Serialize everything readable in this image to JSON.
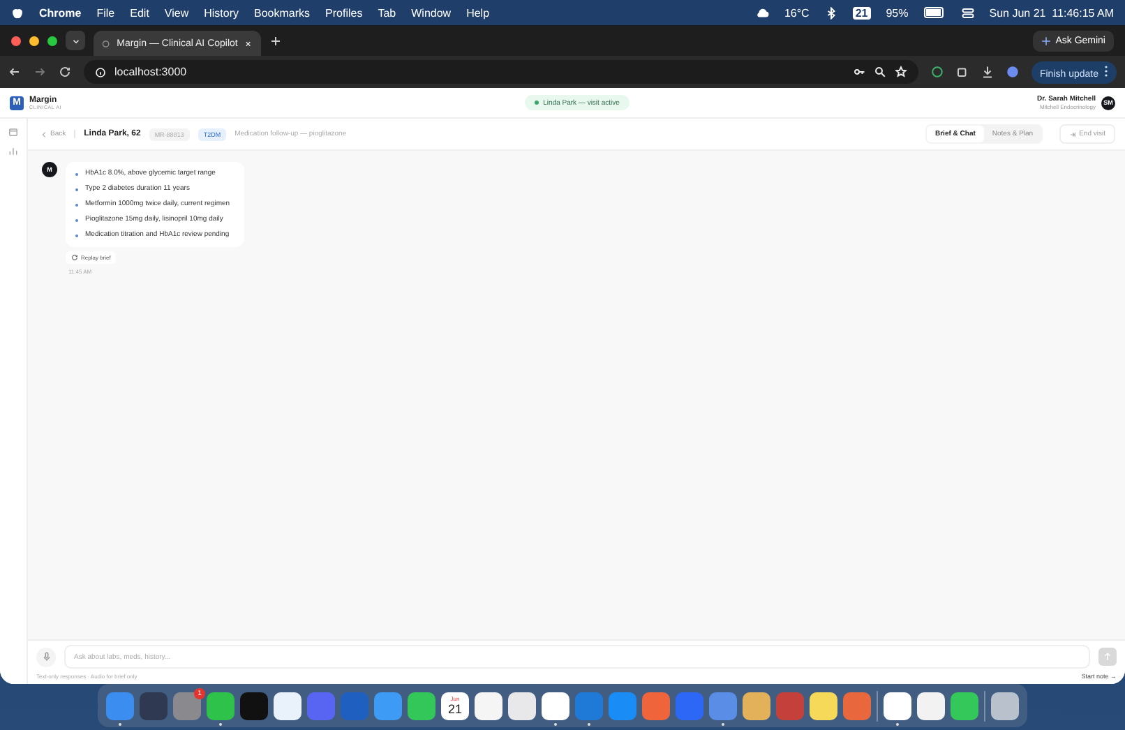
{
  "menubar": {
    "app": "Chrome",
    "menus": [
      "File",
      "Edit",
      "View",
      "History",
      "Bookmarks",
      "Profiles",
      "Tab",
      "Window",
      "Help"
    ],
    "weather": "16°C",
    "calendar_day": "21",
    "battery": "95%",
    "clock": "Sun Jun 21  11:46:15 AM"
  },
  "browser": {
    "tab_title": "Margin — Clinical AI Copilot",
    "ask_button": "Ask Gemini",
    "url": "localhost:3000",
    "update_button": "Finish update"
  },
  "app": {
    "logo_letter": "M",
    "brand": "Margin",
    "brand_sub": "CLINICAL AI",
    "status_pill": "Linda Park — visit active",
    "user_name": "Dr. Sarah Mitchell",
    "user_org": "Mitchell Endocrinology",
    "user_initials": "SM",
    "back": "Back",
    "patient": "Linda Park, 62",
    "record_id": "MR-88813",
    "condition": "T2DM",
    "visit_reason": "Medication follow-up — pioglitazone",
    "tabs": [
      {
        "label": "Brief & Chat",
        "selected": true
      },
      {
        "label": "Notes & Plan",
        "selected": false
      }
    ],
    "end_visit": "End visit",
    "message": {
      "avatar": "M",
      "bullets": [
        "HbA1c 8.0%, above glycemic target range",
        "Type 2 diabetes duration 11 years",
        "Metformin 1000mg twice daily, current regimen",
        "Pioglitazone 15mg daily, lisinopril 10mg daily",
        "Medication titration and HbA1c review pending"
      ],
      "replay": "Replay brief",
      "time": "11:45 AM"
    },
    "composer": {
      "placeholder": "Ask about labs, meds, history...",
      "hint": "Text-only responses · Audio for brief only",
      "start_note": "Start note →"
    }
  },
  "dock": [
    {
      "color": "#3b8ef0",
      "running": true
    },
    {
      "color": "#2f3a52",
      "running": false
    },
    {
      "color": "#8a8a8e",
      "running": false,
      "badge": "1"
    },
    {
      "color": "#2fc24a",
      "running": true
    },
    {
      "color": "#111111",
      "running": false
    },
    {
      "color": "#e9f1fb",
      "running": false
    },
    {
      "color": "#5865f2",
      "running": false
    },
    {
      "color": "#1f5fbf",
      "running": false
    },
    {
      "color": "#3d9bf5",
      "running": false
    },
    {
      "color": "#33c759",
      "running": false
    },
    {
      "kind": "calendar",
      "color": "#ffffff",
      "running": false,
      "month": "Jun",
      "day": "21"
    },
    {
      "color": "#f5f5f5",
      "running": false
    },
    {
      "color": "#e8e8ea",
      "running": false
    },
    {
      "color": "#ffffff",
      "running": true
    },
    {
      "color": "#1e7ad6",
      "running": true
    },
    {
      "color": "#1a8cf5",
      "running": false
    },
    {
      "color": "#f0643c",
      "running": false
    },
    {
      "color": "#2d67f5",
      "running": false
    },
    {
      "color": "#5a8ee6",
      "running": true
    },
    {
      "color": "#e3b15a",
      "running": false
    },
    {
      "color": "#c4413b",
      "running": false
    },
    {
      "color": "#f7d95a",
      "running": false
    },
    {
      "color": "#e8673c",
      "running": false
    },
    {
      "kind": "divider"
    },
    {
      "color": "#ffffff",
      "running": true
    },
    {
      "color": "#f2f2f2",
      "running": false
    },
    {
      "color": "#34c759",
      "running": false
    },
    {
      "kind": "divider"
    },
    {
      "color": "#b9c2cc",
      "running": false
    }
  ]
}
